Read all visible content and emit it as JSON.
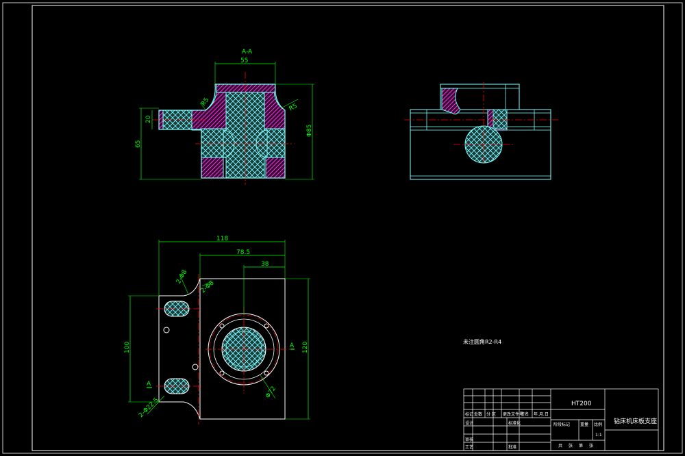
{
  "colors": {
    "background": "#000000",
    "frame": "#ffffff",
    "outline": "#7fffff",
    "dimension": "#00ff00",
    "centerline": "#ff0000",
    "hatch_red": "#ff0000",
    "hatch_purple": "#ff00ff",
    "section_fill": "#7fffff"
  },
  "views": {
    "front": {
      "section_mark": "A-A",
      "dims": {
        "top_width": "55",
        "left_height": "65",
        "boss_height": "20",
        "right_height": "Φ85",
        "r_left": "R5",
        "r_right": "R5"
      }
    },
    "plan": {
      "dims": {
        "overall": "118",
        "mid": "78.5",
        "inner": "38",
        "height_left": "100",
        "height_right": "120",
        "phi": "Φ72"
      },
      "notes": {
        "d1": "2-Φ8",
        "d2": "2-Φ6",
        "d3": "2-Φ22.5",
        "mark_a": "A",
        "mark_b": "A"
      }
    }
  },
  "tech_note": "未注圆角R2-R4",
  "title_block": {
    "material": "HT200",
    "part_name": "钻床机床板支座",
    "labels": {
      "biaoji": "标记",
      "chushu": "处数",
      "fenqu": "分 区",
      "wenjian": "更改文件号",
      "qianming": "签名",
      "riqi": "年.月.日",
      "sheji": "设计",
      "biaozhunhua": "标准化",
      "jieduan": "阶段标记",
      "zhongliang": "重量",
      "bili": "比例",
      "shenhe": "审核",
      "gongyi": "工艺",
      "pizhun": "批准",
      "gong": "共",
      "zhang": "张",
      "di": "第",
      "zhang2": "张",
      "scale": "1:1"
    }
  }
}
